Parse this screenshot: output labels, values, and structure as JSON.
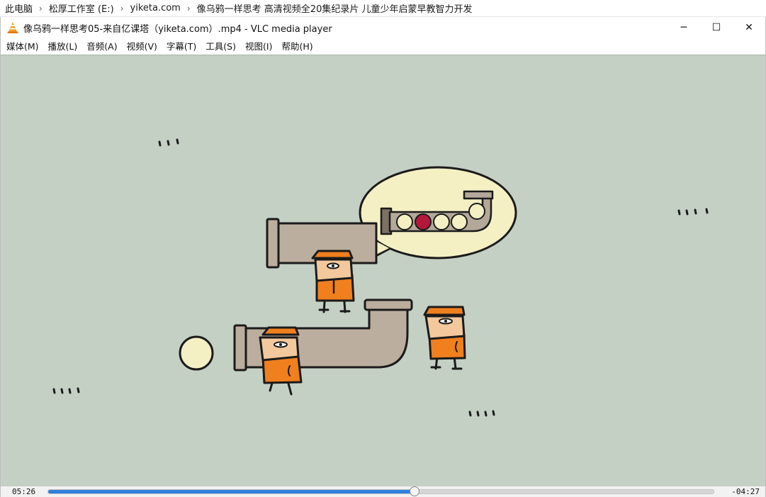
{
  "breadcrumb": {
    "items": [
      "此电脑",
      "松厚工作室 (E:)",
      "yiketa.com",
      "像乌鸦一样思考 高清视频全20集纪录片 儿童少年启蒙早教智力开发"
    ]
  },
  "window": {
    "title": "像乌鸦一样思考05-来自亿课塔（yiketa.com）.mp4 - VLC media player",
    "app_icon": "vlc-cone-icon",
    "controls": {
      "minimize": "─",
      "maximize": "☐",
      "close": "✕"
    }
  },
  "menu": {
    "items": [
      "媒体(M)",
      "播放(L)",
      "音频(A)",
      "视频(V)",
      "字幕(T)",
      "工具(S)",
      "视图(I)",
      "帮助(H)"
    ]
  },
  "player": {
    "elapsed": "05:26",
    "remaining": "-04:27",
    "progress": 0.55,
    "colors": {
      "video_bg": "#c4d0c4",
      "seek_fill": "#2f7fdc",
      "worker_shirt": "#f07f1e"
    }
  }
}
